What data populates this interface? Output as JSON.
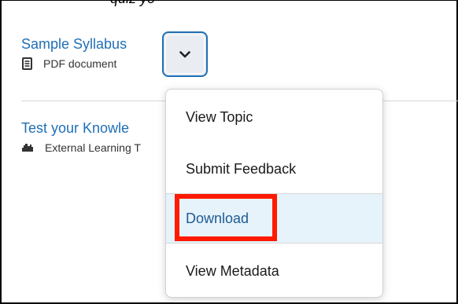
{
  "header": {
    "caption": "quiz yo"
  },
  "topics": [
    {
      "title": "Sample Syllabus",
      "type_label": "PDF document",
      "icon": "document-icon"
    },
    {
      "title": "Test your Knowle",
      "type_label": "External Learning T",
      "icon": "puzzle-icon"
    }
  ],
  "options_button": {
    "icon": "chevron-down-icon"
  },
  "menu": {
    "items": [
      {
        "label": "View Topic"
      },
      {
        "label": "Submit Feedback"
      },
      {
        "label": "Download"
      },
      {
        "label": "View Metadata"
      }
    ],
    "highlighted_label": "Download"
  },
  "colors": {
    "link": "#1f6fb5",
    "highlight_bg": "#e6f3fb",
    "annotation": "#ff1a00"
  }
}
